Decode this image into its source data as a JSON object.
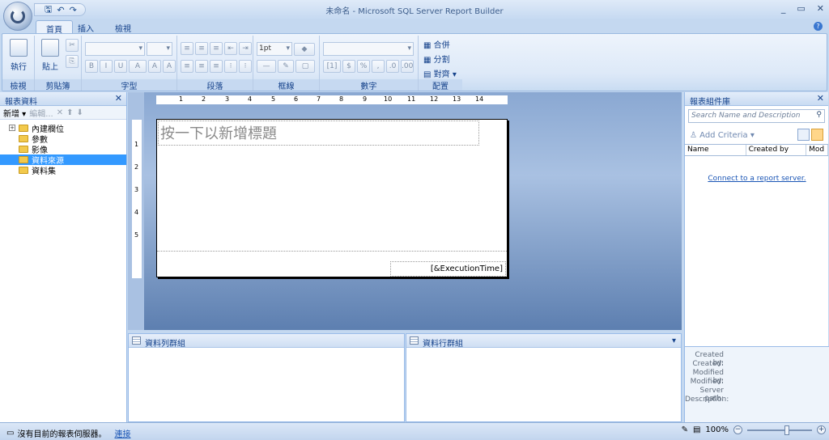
{
  "window": {
    "title": "未命名 - Microsoft SQL Server Report Builder",
    "controls": [
      "_",
      "▭",
      "✕"
    ]
  },
  "qat": {
    "save": "🖫",
    "undo": "↶",
    "redo": "↷"
  },
  "tabs": [
    {
      "label": "首頁"
    },
    {
      "label": "插入"
    },
    {
      "label": "檢視"
    }
  ],
  "ribbon": {
    "groups": {
      "view": {
        "label": "檢視",
        "run_label": "執行"
      },
      "clipboard": {
        "label": "剪貼簿",
        "paste_label": "貼上"
      },
      "font": {
        "label": "字型"
      },
      "paragraph": {
        "label": "段落"
      },
      "border": {
        "label": "框線",
        "width_value": "1pt"
      },
      "number": {
        "label": "數字"
      },
      "layout": {
        "label": "配置",
        "merge": "合併",
        "split": "分割",
        "align": "對齊"
      }
    }
  },
  "left_panel": {
    "title": "報表資料",
    "toolbar": {
      "new_label": "新增",
      "edit_label": "編輯..."
    },
    "tree": [
      {
        "label": "內建欄位",
        "expandable": true
      },
      {
        "label": "參數"
      },
      {
        "label": "影像"
      },
      {
        "label": "資料來源",
        "selected": true
      },
      {
        "label": "資料集"
      }
    ]
  },
  "ruler": {
    "h": [
      "1",
      "2",
      "3",
      "4",
      "5",
      "6",
      "7",
      "8",
      "9",
      "10",
      "11",
      "12",
      "13",
      "14"
    ],
    "v": [
      "1",
      "2",
      "3",
      "4",
      "5"
    ]
  },
  "report": {
    "title_placeholder": "按一下以新增標題",
    "footer_expression": "[&ExecutionTime]"
  },
  "groups": {
    "row_groups_label": "資料列群組",
    "column_groups_label": "資料行群組"
  },
  "right_panel": {
    "title": "報表組件庫",
    "search_placeholder": "Search Name and Description",
    "add_criteria": "Add Criteria",
    "columns": [
      "Name",
      "Created by",
      "Mod"
    ],
    "connect_link": "Connect to a report server.",
    "properties": [
      "Created by:",
      "Created:",
      "Modified by:",
      "Modified:",
      "Server path:",
      "Description:"
    ]
  },
  "status": {
    "message": "沒有目前的報表伺服器。",
    "connect_link": "連接",
    "zoom": "100%"
  }
}
